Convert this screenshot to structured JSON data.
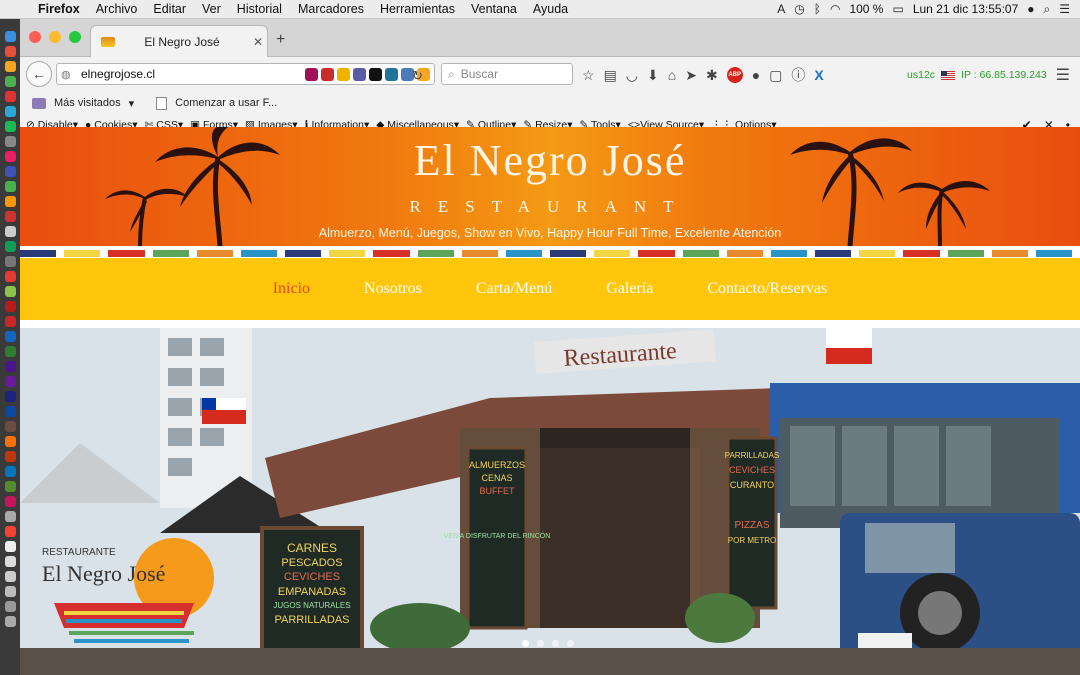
{
  "menubar": {
    "app": "Firefox",
    "menus": [
      "Archivo",
      "Editar",
      "Ver",
      "Historial",
      "Marcadores",
      "Herramientas",
      "Ventana",
      "Ayuda"
    ],
    "battery": "100 %",
    "datetime": "Lun 21 dic  13:55:07"
  },
  "browser": {
    "tab_title": "El Negro José",
    "url": "elnegrojose.cl",
    "search_placeholder": "Buscar",
    "extension_status": "us12c",
    "ip": "IP : 66.85.139.243",
    "bookmarks": [
      "Más visitados",
      "Comenzar a usar F..."
    ],
    "devtools": [
      "Disable",
      "Cookies",
      "CSS",
      "Forms",
      "Images",
      "Information",
      "Miscellaneous",
      "Outline",
      "Resize",
      "Tools",
      "View Source",
      "Options"
    ]
  },
  "site": {
    "brand": "El Negro José",
    "subbrand": "RESTAURANT",
    "slogan": "Almuerzo, Menú, Juegos, Show en Vivo, Happy Hour Full Time, Excelente Atención",
    "nav": [
      "Inicio",
      "Nosotros",
      "Carta/Menú",
      "Galería",
      "Contacto/Reservas"
    ],
    "active_nav": "Inicio",
    "hero": {
      "sign_restaurant": "Restaurante",
      "board_left": [
        "CARNES",
        "PESCADOS",
        "CEVICHES",
        "EMPANADAS",
        "JUGOS NATURALES",
        "PARRILLADAS"
      ],
      "board_center": [
        "ALMUERZOS",
        "CENAS",
        "BUFFET",
        "VEN A DISFRUTAR DEL RINCÓN"
      ],
      "board_right": [
        "PARRILLADAS",
        "CEVICHES",
        "CURANTO",
        "PIZZAS",
        "POR METRO"
      ],
      "logo_small": "RESTAURANTE",
      "logo_name": "El Negro José",
      "slide_count": 4,
      "active_slide": 1
    }
  },
  "colors": {
    "banner": "#f17a0e",
    "nav_bg": "#ffc60b",
    "active": "#e24a13",
    "stripes": [
      "#2b3a78",
      "#f2d542",
      "#d63027",
      "#5aa55a",
      "#e8892a",
      "#2a93c8"
    ]
  }
}
